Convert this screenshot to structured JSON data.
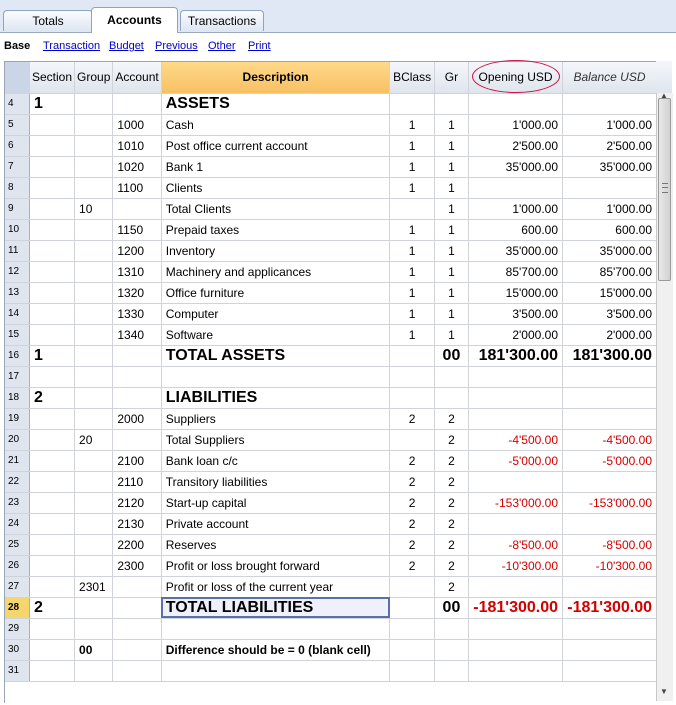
{
  "tabs": [
    {
      "label": "Accounts",
      "active": true
    },
    {
      "label": "Transactions",
      "active": false
    },
    {
      "label": "Totals",
      "active": false
    }
  ],
  "views": [
    {
      "label": "Base",
      "active": true
    },
    {
      "label": "Transaction",
      "active": false
    },
    {
      "label": "Budget",
      "active": false
    },
    {
      "label": "Previous",
      "active": false
    },
    {
      "label": "Other",
      "active": false
    },
    {
      "label": "Print",
      "active": false
    }
  ],
  "columns": {
    "section": "Section",
    "group": "Group",
    "account": "Account",
    "description": "Description",
    "bclass": "BClass",
    "gr": "Gr",
    "opening": "Opening USD",
    "balance": "Balance USD"
  },
  "colors": {
    "negative": "#d40000",
    "highlight_ellipse": "#cc1040",
    "header_accent": "#f8c064"
  },
  "rows": [
    {
      "n": "4",
      "section": "1",
      "group": "",
      "account": "",
      "description": "ASSETS",
      "bclass": "",
      "gr": "",
      "opening": "",
      "balance": "",
      "style": "big"
    },
    {
      "n": "5",
      "section": "",
      "group": "",
      "account": "1000",
      "description": "Cash",
      "bclass": "1",
      "gr": "1",
      "opening": "1'000.00",
      "balance": "1'000.00"
    },
    {
      "n": "6",
      "section": "",
      "group": "",
      "account": "1010",
      "description": "Post office current account",
      "bclass": "1",
      "gr": "1",
      "opening": "2'500.00",
      "balance": "2'500.00"
    },
    {
      "n": "7",
      "section": "",
      "group": "",
      "account": "1020",
      "description": "Bank 1",
      "bclass": "1",
      "gr": "1",
      "opening": "35'000.00",
      "balance": "35'000.00"
    },
    {
      "n": "8",
      "section": "",
      "group": "",
      "account": "1100",
      "description": "Clients",
      "bclass": "1",
      "gr": "1",
      "opening": "",
      "balance": ""
    },
    {
      "n": "9",
      "section": "",
      "group": "10",
      "account": "",
      "description": "Total Clients",
      "bclass": "",
      "gr": "1",
      "opening": "1'000.00",
      "balance": "1'000.00"
    },
    {
      "n": "10",
      "section": "",
      "group": "",
      "account": "1150",
      "description": "Prepaid taxes",
      "bclass": "1",
      "gr": "1",
      "opening": "600.00",
      "balance": "600.00"
    },
    {
      "n": "11",
      "section": "",
      "group": "",
      "account": "1200",
      "description": "Inventory",
      "bclass": "1",
      "gr": "1",
      "opening": "35'000.00",
      "balance": "35'000.00"
    },
    {
      "n": "12",
      "section": "",
      "group": "",
      "account": "1310",
      "description": "Machinery and applicances",
      "bclass": "1",
      "gr": "1",
      "opening": "85'700.00",
      "balance": "85'700.00"
    },
    {
      "n": "13",
      "section": "",
      "group": "",
      "account": "1320",
      "description": "Office furniture",
      "bclass": "1",
      "gr": "1",
      "opening": "15'000.00",
      "balance": "15'000.00"
    },
    {
      "n": "14",
      "section": "",
      "group": "",
      "account": "1330",
      "description": "Computer",
      "bclass": "1",
      "gr": "1",
      "opening": "3'500.00",
      "balance": "3'500.00"
    },
    {
      "n": "15",
      "section": "",
      "group": "",
      "account": "1340",
      "description": "Software",
      "bclass": "1",
      "gr": "1",
      "opening": "2'000.00",
      "balance": "2'000.00"
    },
    {
      "n": "16",
      "section": "1",
      "group": "",
      "account": "",
      "description": "TOTAL ASSETS",
      "bclass": "",
      "gr": "00",
      "opening": "181'300.00",
      "balance": "181'300.00",
      "style": "big"
    },
    {
      "n": "17",
      "section": "",
      "group": "",
      "account": "",
      "description": "",
      "bclass": "",
      "gr": "",
      "opening": "",
      "balance": ""
    },
    {
      "n": "18",
      "section": "2",
      "group": "",
      "account": "",
      "description": "LIABILITIES",
      "bclass": "",
      "gr": "",
      "opening": "",
      "balance": "",
      "style": "big"
    },
    {
      "n": "19",
      "section": "",
      "group": "",
      "account": "2000",
      "description": "Suppliers",
      "bclass": "2",
      "gr": "2",
      "opening": "",
      "balance": ""
    },
    {
      "n": "20",
      "section": "",
      "group": "20",
      "account": "",
      "description": "Total Suppliers",
      "bclass": "",
      "gr": "2",
      "opening": "-4'500.00",
      "balance": "-4'500.00",
      "neg": true
    },
    {
      "n": "21",
      "section": "",
      "group": "",
      "account": "2100",
      "description": "Bank loan c/c",
      "bclass": "2",
      "gr": "2",
      "opening": "-5'000.00",
      "balance": "-5'000.00",
      "neg": true
    },
    {
      "n": "22",
      "section": "",
      "group": "",
      "account": "2110",
      "description": "Transitory liabilities",
      "bclass": "2",
      "gr": "2",
      "opening": "",
      "balance": ""
    },
    {
      "n": "23",
      "section": "",
      "group": "",
      "account": "2120",
      "description": "Start-up capital",
      "bclass": "2",
      "gr": "2",
      "opening": "-153'000.00",
      "balance": "-153'000.00",
      "neg": true
    },
    {
      "n": "24",
      "section": "",
      "group": "",
      "account": "2130",
      "description": "Private account",
      "bclass": "2",
      "gr": "2",
      "opening": "",
      "balance": ""
    },
    {
      "n": "25",
      "section": "",
      "group": "",
      "account": "2200",
      "description": "Reserves",
      "bclass": "2",
      "gr": "2",
      "opening": "-8'500.00",
      "balance": "-8'500.00",
      "neg": true
    },
    {
      "n": "26",
      "section": "",
      "group": "",
      "account": "2300",
      "description": "Profit or loss brought forward",
      "bclass": "2",
      "gr": "2",
      "opening": "-10'300.00",
      "balance": "-10'300.00",
      "neg": true
    },
    {
      "n": "27",
      "section": "",
      "group": "2301",
      "account": "",
      "description": "Profit or loss of the current year",
      "bclass": "",
      "gr": "2",
      "opening": "",
      "balance": ""
    },
    {
      "n": "28",
      "section": "2",
      "group": "",
      "account": "",
      "description": "TOTAL LIABILITIES",
      "bclass": "",
      "gr": "00",
      "opening": "-181'300.00",
      "balance": "-181'300.00",
      "style": "big",
      "neg": true,
      "selected": true
    },
    {
      "n": "29",
      "section": "",
      "group": "",
      "account": "",
      "description": "",
      "bclass": "",
      "gr": "",
      "opening": "",
      "balance": ""
    },
    {
      "n": "30",
      "section": "",
      "group": "00",
      "account": "",
      "description": "Difference should be = 0 (blank cell)",
      "bclass": "",
      "gr": "",
      "opening": "",
      "balance": "",
      "style": "boldrow"
    },
    {
      "n": "31",
      "section": "",
      "group": "",
      "account": "",
      "description": "",
      "bclass": "",
      "gr": "",
      "opening": "",
      "balance": ""
    }
  ]
}
